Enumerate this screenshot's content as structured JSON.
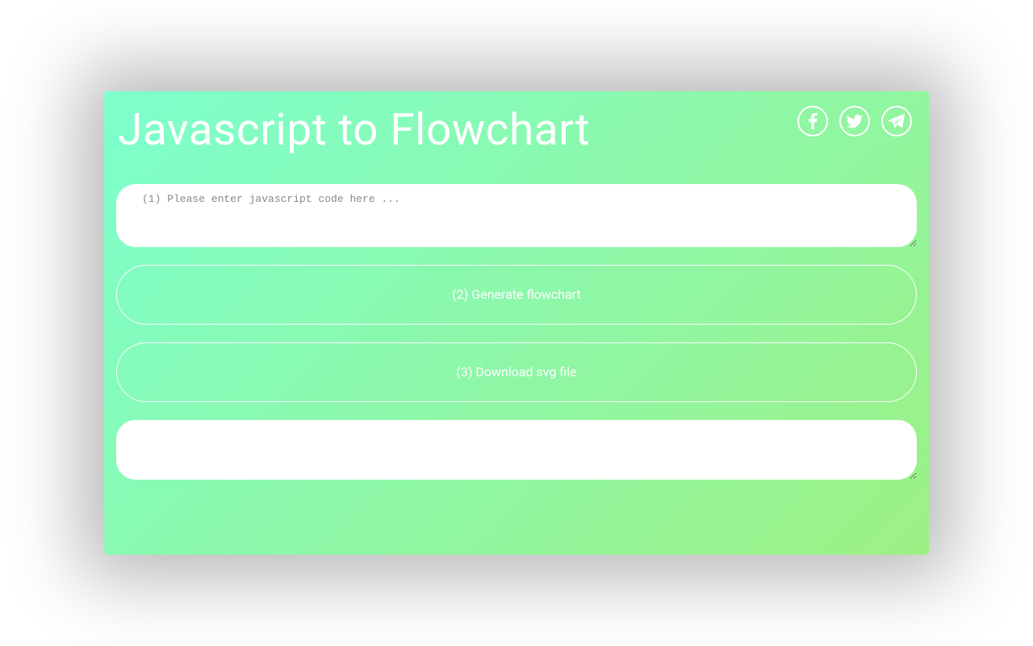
{
  "header": {
    "title": "Javascript to Flowchart"
  },
  "social": {
    "facebook": "facebook",
    "twitter": "twitter",
    "telegram": "telegram"
  },
  "input": {
    "placeholder": "(1) Please enter javascript code here ...",
    "value": ""
  },
  "buttons": {
    "generate": "(2) Generate flowchart",
    "download": "(3) Download svg file"
  },
  "output": {
    "value": ""
  }
}
